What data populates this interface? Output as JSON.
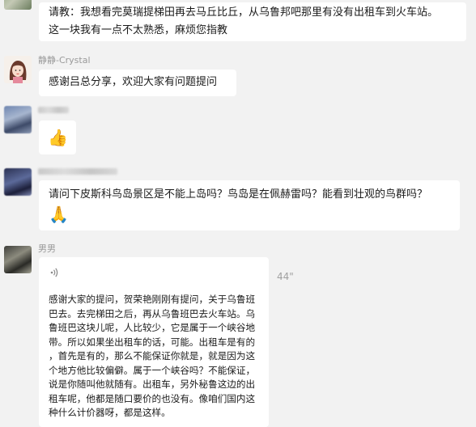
{
  "messages": [
    {
      "sender": "",
      "text_lines": [
        "请教：我想看完莫瑞提梯田再去马丘比丘，从乌鲁邦吧那里有没有出租车到火车站。",
        "这一块我有一点不太熟悉，麻烦您指教"
      ]
    },
    {
      "sender": "静静-Crystal",
      "text": "感谢吕总分享，欢迎大家有问题提问"
    },
    {
      "sender": "",
      "emoji": "👍"
    },
    {
      "sender": "",
      "text": "请问下皮斯科鸟岛景区是不能上岛吗？鸟岛是在佩赫雷吗？能看到壮观的鸟群吗？",
      "emoji": "🙏"
    },
    {
      "sender": "男男",
      "voice_icon": "voice-wave-icon",
      "voice_duration": "44\"",
      "text_lines": [
        "感谢大家的提问，贺荣艳刚刚有提问，关于乌鲁班",
        "巴去。去完梯田之后，再从乌鲁班巴去火车站。乌",
        "鲁班巴这块儿呢，人比较少，它是属于一个峡谷地",
        "带。所以如果坐出租车的话，可能。出租车是有的",
        "，首先是有的，那么不能保证你就是，就是因为这",
        "个地方他比较偏僻。属于一个峡谷吗？不能保证，",
        "说是你随叫他就随有。出租车，另外秘鲁这边的出",
        "租车呢，他都是随口要价的也没有。像咱们国内这",
        "种什么计价器呀，都是这样。"
      ]
    }
  ]
}
